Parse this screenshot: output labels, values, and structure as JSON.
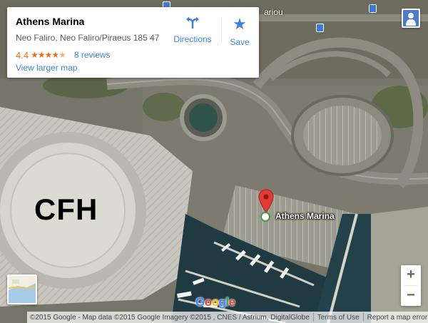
{
  "place": {
    "name": "Athens Marina",
    "address": "Neo Faliro, Neo Faliro/Piraeus 185 47",
    "rating": "4.4",
    "stars_filled": 4.4,
    "reviews": "8 reviews",
    "larger_map": "View larger map"
  },
  "actions": {
    "directions_label": "Directions",
    "directions_icon": "directions-icon",
    "save_label": "Save",
    "save_icon": "star-icon"
  },
  "map": {
    "type": "satellite",
    "overlay_text": "CFH",
    "marker_label": "Athens Marina",
    "street_fragment": "ariou",
    "pin_color": "#e53935"
  },
  "controls": {
    "zoom_in": "+",
    "zoom_out": "−",
    "pegman_icon": "pegman-icon",
    "minimap_icon": "map-thumbnail-icon"
  },
  "footer": {
    "logo_letters": [
      "G",
      "o",
      "o",
      "g",
      "l",
      "e"
    ],
    "attribution": "©2015 Google - Map data ©2015 Google Imagery ©2015 , CNES / Astrium, DigitalGlobe",
    "terms": "Terms of Use",
    "report": "Report a map error"
  },
  "colors": {
    "link": "#3a84df",
    "rating": "#e7711b"
  }
}
